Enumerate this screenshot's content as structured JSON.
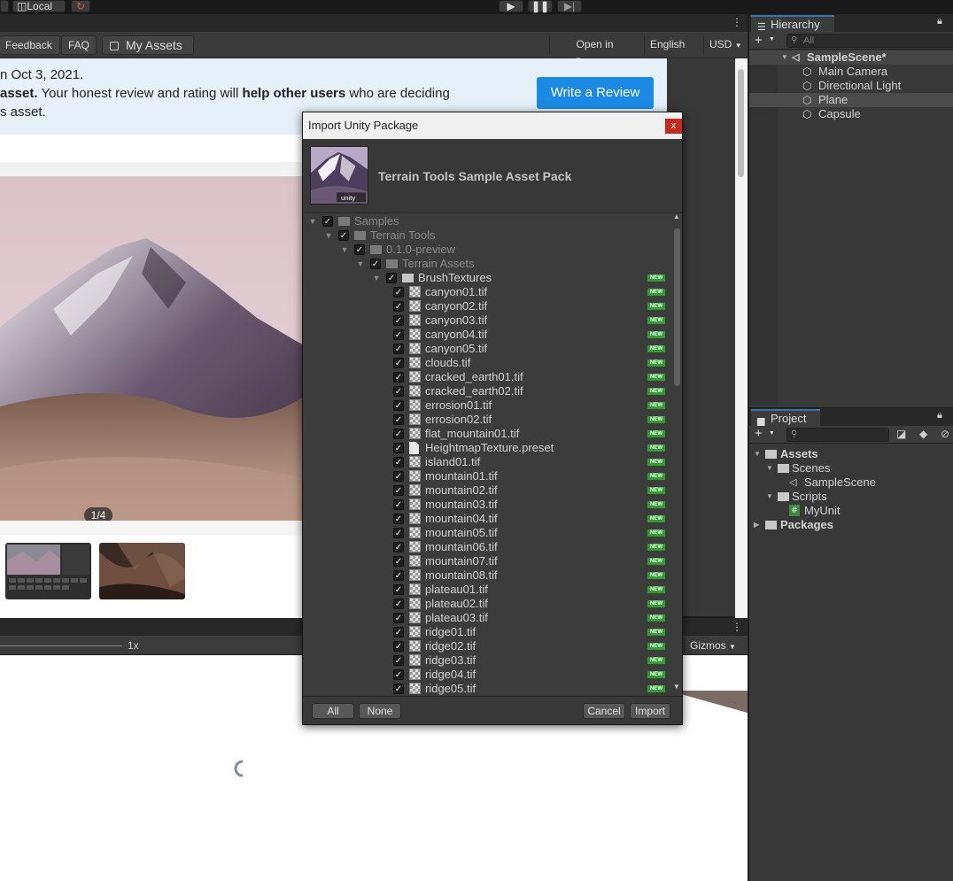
{
  "toolbar": {
    "pivot_label": "Local"
  },
  "store": {
    "feedback": "Feedback",
    "faq": "FAQ",
    "my_assets": "My Assets",
    "open_in_browser": "Open in Browser",
    "language": "English",
    "currency": "USD",
    "banner_line1": "n Oct 3, 2021.",
    "banner_line2_bold1": "asset.",
    "banner_line2_mid": " Your honest review and rating will ",
    "banner_line2_bold2": "help other users",
    "banner_line2_end": " who are deciding",
    "banner_line3": "s asset.",
    "review_button": "Write a Review",
    "pager": "1/4"
  },
  "scene": {
    "zoom": "1x",
    "gizmos": "Gizmos"
  },
  "hierarchy": {
    "tab": "Hierarchy",
    "search_placeholder": "All",
    "items": [
      {
        "label": "SampleScene*"
      },
      {
        "label": "Main Camera"
      },
      {
        "label": "Directional Light"
      },
      {
        "label": "Plane"
      },
      {
        "label": "Capsule"
      }
    ]
  },
  "project": {
    "tab": "Project",
    "items": [
      {
        "label": "Assets"
      },
      {
        "label": "Scenes"
      },
      {
        "label": "SampleScene"
      },
      {
        "label": "Scripts"
      },
      {
        "label": "MyUnit"
      },
      {
        "label": "Packages"
      }
    ]
  },
  "dialog": {
    "title": "Import Unity Package",
    "close": "x",
    "package_name": "Terrain Tools Sample Asset Pack",
    "unity_badge": "unity",
    "new_badge": "NEW",
    "tree": [
      {
        "label": "Samples",
        "type": "folder",
        "level": 0,
        "dim": true
      },
      {
        "label": "Terrain Tools",
        "type": "folder",
        "level": 1,
        "dim": true
      },
      {
        "label": "0.1.0-preview",
        "type": "folder",
        "level": 2,
        "dim": true
      },
      {
        "label": "Terrain Assets",
        "type": "folder",
        "level": 3,
        "dim": true
      },
      {
        "label": "BrushTextures",
        "type": "folder",
        "level": 4,
        "new": true
      },
      {
        "label": "canyon01.tif",
        "type": "tex",
        "level": 5,
        "new": true
      },
      {
        "label": "canyon02.tif",
        "type": "tex",
        "level": 5,
        "new": true
      },
      {
        "label": "canyon03.tif",
        "type": "tex",
        "level": 5,
        "new": true
      },
      {
        "label": "canyon04.tif",
        "type": "tex",
        "level": 5,
        "new": true
      },
      {
        "label": "canyon05.tif",
        "type": "tex",
        "level": 5,
        "new": true
      },
      {
        "label": "clouds.tif",
        "type": "tex",
        "level": 5,
        "new": true
      },
      {
        "label": "cracked_earth01.tif",
        "type": "tex",
        "level": 5,
        "new": true
      },
      {
        "label": "cracked_earth02.tif",
        "type": "tex",
        "level": 5,
        "new": true
      },
      {
        "label": "errosion01.tif",
        "type": "tex",
        "level": 5,
        "new": true
      },
      {
        "label": "errosion02.tif",
        "type": "tex",
        "level": 5,
        "new": true
      },
      {
        "label": "flat_mountain01.tif",
        "type": "tex",
        "level": 5,
        "new": true
      },
      {
        "label": "HeightmapTexture.preset",
        "type": "file",
        "level": 5,
        "new": true
      },
      {
        "label": "island01.tif",
        "type": "tex",
        "level": 5,
        "new": true
      },
      {
        "label": "mountain01.tif",
        "type": "tex",
        "level": 5,
        "new": true
      },
      {
        "label": "mountain02.tif",
        "type": "tex",
        "level": 5,
        "new": true
      },
      {
        "label": "mountain03.tif",
        "type": "tex",
        "level": 5,
        "new": true
      },
      {
        "label": "mountain04.tif",
        "type": "tex",
        "level": 5,
        "new": true
      },
      {
        "label": "mountain05.tif",
        "type": "tex",
        "level": 5,
        "new": true
      },
      {
        "label": "mountain06.tif",
        "type": "tex",
        "level": 5,
        "new": true
      },
      {
        "label": "mountain07.tif",
        "type": "tex",
        "level": 5,
        "new": true
      },
      {
        "label": "mountain08.tif",
        "type": "tex",
        "level": 5,
        "new": true
      },
      {
        "label": "plateau01.tif",
        "type": "tex",
        "level": 5,
        "new": true
      },
      {
        "label": "plateau02.tif",
        "type": "tex",
        "level": 5,
        "new": true
      },
      {
        "label": "plateau03.tif",
        "type": "tex",
        "level": 5,
        "new": true
      },
      {
        "label": "ridge01.tif",
        "type": "tex",
        "level": 5,
        "new": true
      },
      {
        "label": "ridge02.tif",
        "type": "tex",
        "level": 5,
        "new": true
      },
      {
        "label": "ridge03.tif",
        "type": "tex",
        "level": 5,
        "new": true
      },
      {
        "label": "ridge04.tif",
        "type": "tex",
        "level": 5,
        "new": true
      },
      {
        "label": "ridge05.tif",
        "type": "tex",
        "level": 5,
        "new": true
      }
    ],
    "buttons": {
      "all": "All",
      "none": "None",
      "cancel": "Cancel",
      "import": "Import"
    }
  },
  "colors": {
    "accent": "#1c8ae5",
    "new_badge": "#2e9e2e",
    "close": "#c42b1c",
    "selection": "#4b4b4b"
  }
}
